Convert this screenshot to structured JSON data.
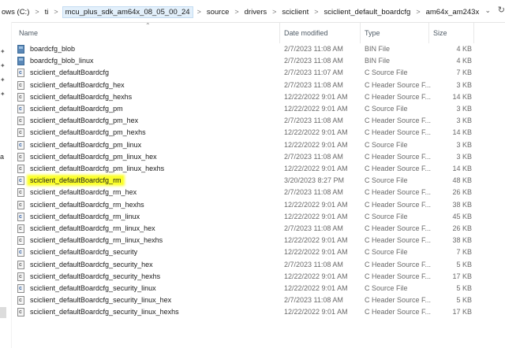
{
  "breadcrumb": {
    "items": [
      "ows (C:)",
      "ti",
      "mcu_plus_sdk_am64x_08_05_00_24",
      "source",
      "drivers",
      "sciclient",
      "sciclient_default_boardcfg",
      "am64x_am243x"
    ],
    "separator": ">"
  },
  "nav": {
    "partial_label": "a"
  },
  "columns": {
    "name": "Name",
    "date": "Date modified",
    "type": "Type",
    "size": "Size"
  },
  "highlight_color": "#fbff2b",
  "files": [
    {
      "name": "boardcfg_blob",
      "date": "2/7/2023 11:08 AM",
      "type": "BIN File",
      "size": "4 KB",
      "icon": "bin-file-icon"
    },
    {
      "name": "boardcfg_blob_linux",
      "date": "2/7/2023 11:08 AM",
      "type": "BIN File",
      "size": "4 KB",
      "icon": "bin-file-icon"
    },
    {
      "name": "sciclient_defaultBoardcfg",
      "date": "2/7/2023 11:07 AM",
      "type": "C Source File",
      "size": "7 KB",
      "icon": "c-source-file-icon"
    },
    {
      "name": "sciclient_defaultBoardcfg_hex",
      "date": "2/7/2023 11:08 AM",
      "type": "C Header Source F...",
      "size": "3 KB",
      "icon": "c-header-file-icon"
    },
    {
      "name": "sciclient_defaultBoardcfg_hexhs",
      "date": "12/22/2022 9:01 AM",
      "type": "C Header Source F...",
      "size": "14 KB",
      "icon": "c-header-file-icon"
    },
    {
      "name": "sciclient_defaultBoardcfg_pm",
      "date": "12/22/2022 9:01 AM",
      "type": "C Source File",
      "size": "3 KB",
      "icon": "c-source-file-icon"
    },
    {
      "name": "sciclient_defaultBoardcfg_pm_hex",
      "date": "2/7/2023 11:08 AM",
      "type": "C Header Source F...",
      "size": "3 KB",
      "icon": "c-header-file-icon"
    },
    {
      "name": "sciclient_defaultBoardcfg_pm_hexhs",
      "date": "12/22/2022 9:01 AM",
      "type": "C Header Source F...",
      "size": "14 KB",
      "icon": "c-header-file-icon"
    },
    {
      "name": "sciclient_defaultBoardcfg_pm_linux",
      "date": "12/22/2022 9:01 AM",
      "type": "C Source File",
      "size": "3 KB",
      "icon": "c-source-file-icon"
    },
    {
      "name": "sciclient_defaultBoardcfg_pm_linux_hex",
      "date": "2/7/2023 11:08 AM",
      "type": "C Header Source F...",
      "size": "3 KB",
      "icon": "c-header-file-icon"
    },
    {
      "name": "sciclient_defaultBoardcfg_pm_linux_hexhs",
      "date": "12/22/2022 9:01 AM",
      "type": "C Header Source F...",
      "size": "14 KB",
      "icon": "c-header-file-icon"
    },
    {
      "name": "sciclient_defaultBoardcfg_rm",
      "date": "3/20/2023 8:27 PM",
      "type": "C Source File",
      "size": "48 KB",
      "icon": "c-source-file-icon",
      "highlighted": true
    },
    {
      "name": "sciclient_defaultBoardcfg_rm_hex",
      "date": "2/7/2023 11:08 AM",
      "type": "C Header Source F...",
      "size": "26 KB",
      "icon": "c-header-file-icon"
    },
    {
      "name": "sciclient_defaultBoardcfg_rm_hexhs",
      "date": "12/22/2022 9:01 AM",
      "type": "C Header Source F...",
      "size": "38 KB",
      "icon": "c-header-file-icon"
    },
    {
      "name": "sciclient_defaultBoardcfg_rm_linux",
      "date": "12/22/2022 9:01 AM",
      "type": "C Source File",
      "size": "45 KB",
      "icon": "c-source-file-icon"
    },
    {
      "name": "sciclient_defaultBoardcfg_rm_linux_hex",
      "date": "2/7/2023 11:08 AM",
      "type": "C Header Source F...",
      "size": "26 KB",
      "icon": "c-header-file-icon"
    },
    {
      "name": "sciclient_defaultBoardcfg_rm_linux_hexhs",
      "date": "12/22/2022 9:01 AM",
      "type": "C Header Source F...",
      "size": "38 KB",
      "icon": "c-header-file-icon"
    },
    {
      "name": "sciclient_defaultBoardcfg_security",
      "date": "12/22/2022 9:01 AM",
      "type": "C Source File",
      "size": "7 KB",
      "icon": "c-source-file-icon"
    },
    {
      "name": "sciclient_defaultBoardcfg_security_hex",
      "date": "2/7/2023 11:08 AM",
      "type": "C Header Source F...",
      "size": "5 KB",
      "icon": "c-header-file-icon"
    },
    {
      "name": "sciclient_defaultBoardcfg_security_hexhs",
      "date": "12/22/2022 9:01 AM",
      "type": "C Header Source F...",
      "size": "17 KB",
      "icon": "c-header-file-icon"
    },
    {
      "name": "sciclient_defaultBoardcfg_security_linux",
      "date": "12/22/2022 9:01 AM",
      "type": "C Source File",
      "size": "5 KB",
      "icon": "c-source-file-icon"
    },
    {
      "name": "sciclient_defaultBoardcfg_security_linux_hex",
      "date": "2/7/2023 11:08 AM",
      "type": "C Header Source F...",
      "size": "5 KB",
      "icon": "c-header-file-icon"
    },
    {
      "name": "sciclient_defaultBoardcfg_security_linux_hexhs",
      "date": "12/22/2022 9:01 AM",
      "type": "C Header Source F...",
      "size": "17 KB",
      "icon": "c-header-file-icon"
    }
  ]
}
